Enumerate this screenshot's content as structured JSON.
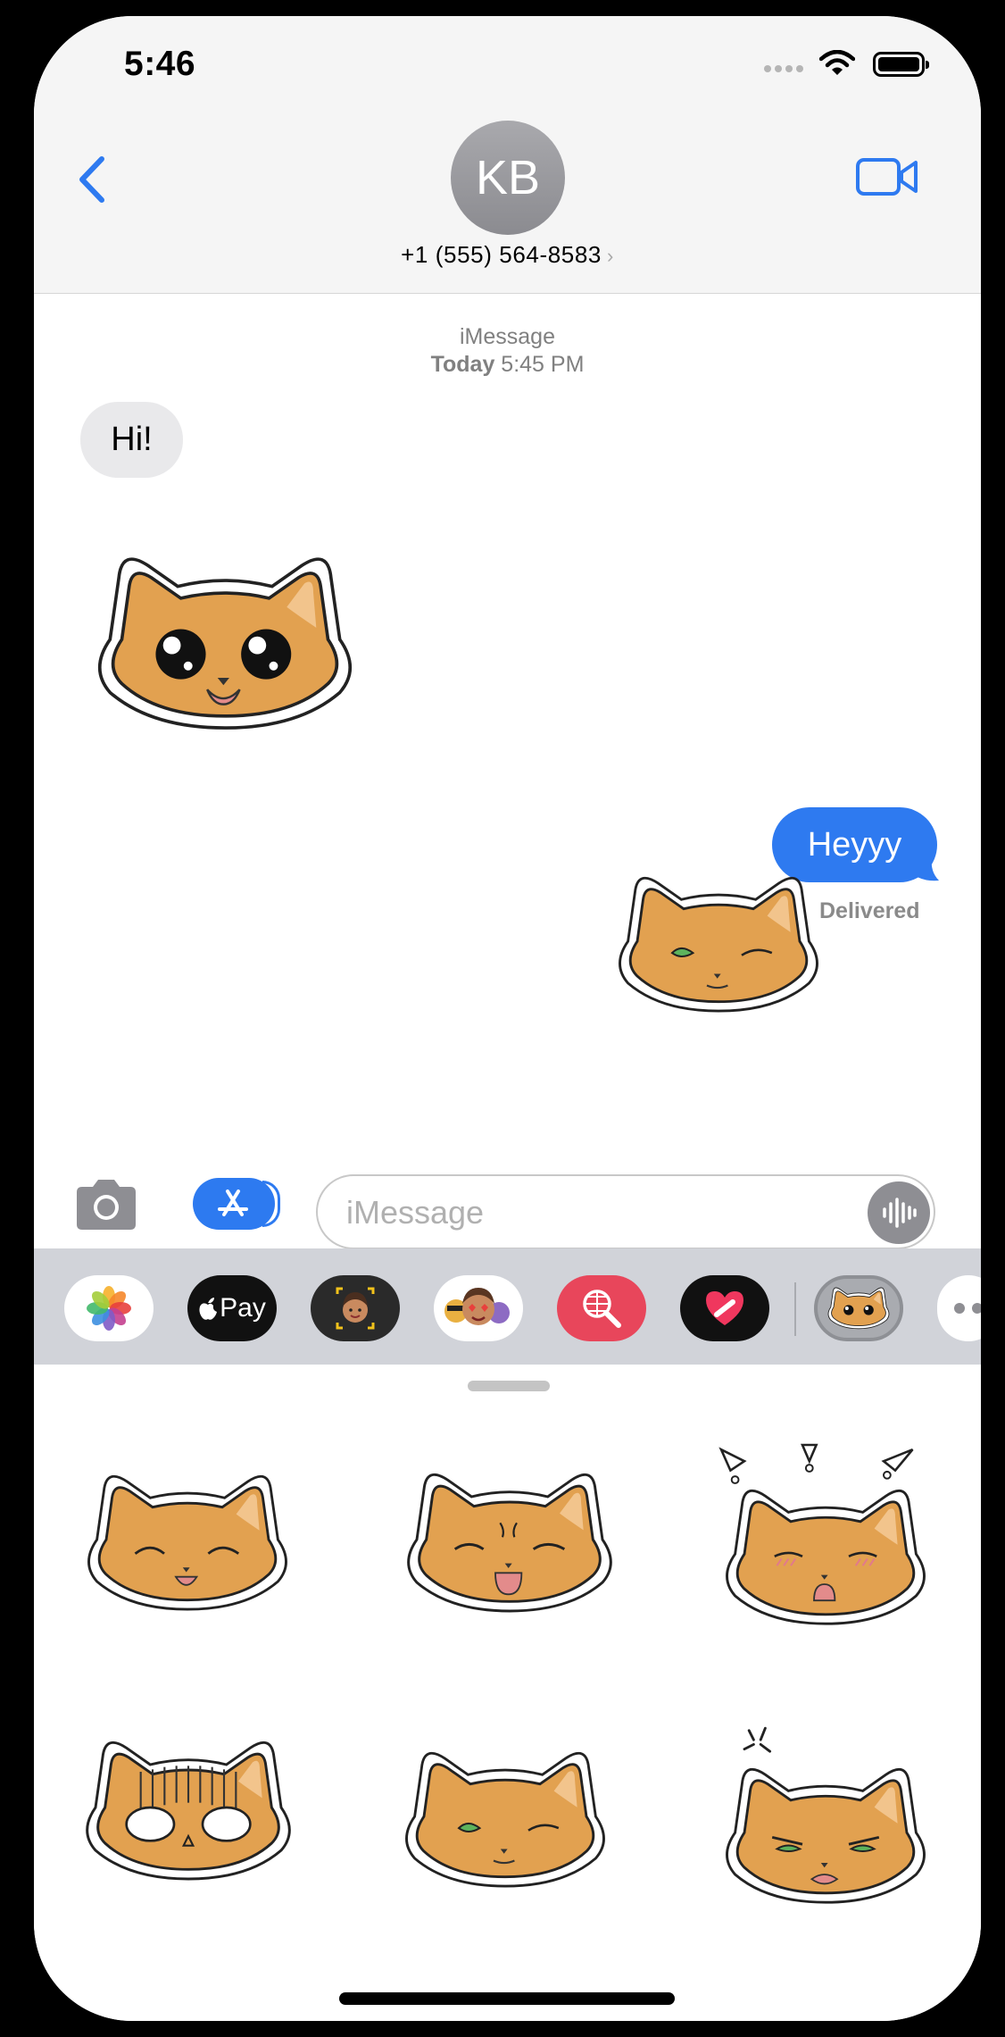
{
  "status_bar": {
    "time": "5:46"
  },
  "header": {
    "avatar_initials": "KB",
    "contact": "+1 (555) 564-8583",
    "chevron": "›"
  },
  "conversation": {
    "service": "iMessage",
    "timestamp_day": "Today",
    "timestamp_time": "5:45 PM",
    "incoming_text": "Hi!",
    "outgoing_text": "Heyyy",
    "delivery_status": "Delivered",
    "stickers": [
      {
        "name": "cat-big-eyes-sticker",
        "expression": "big sparkling eyes"
      },
      {
        "name": "cat-wink-sticker",
        "expression": "winking"
      }
    ]
  },
  "input": {
    "placeholder": "iMessage"
  },
  "app_strip": {
    "items": [
      {
        "name": "photos",
        "icon": "photos-flower-icon"
      },
      {
        "name": "apple-pay",
        "label": "Pay",
        "icon": "apple-logo-icon"
      },
      {
        "name": "memoji",
        "icon": "memoji-icon"
      },
      {
        "name": "memoji-stickers",
        "icon": "emoji-faces-icon"
      },
      {
        "name": "image-search",
        "icon": "globe-search-icon"
      },
      {
        "name": "digital-touch",
        "icon": "heart-icon"
      },
      {
        "name": "cat-stickers",
        "icon": "cat-face-icon",
        "selected": true
      },
      {
        "name": "more",
        "icon": "more-icon"
      }
    ]
  },
  "sticker_drawer": {
    "stickers": [
      {
        "name": "cat-happy-closed-eyes"
      },
      {
        "name": "cat-laughing"
      },
      {
        "name": "cat-surprised-blush"
      },
      {
        "name": "cat-shocked-white-eyes"
      },
      {
        "name": "cat-wink"
      },
      {
        "name": "cat-annoyed"
      }
    ]
  },
  "colors": {
    "accent_blue": "#2e7af0",
    "incoming_bubble": "#e9e9eb",
    "cat_fur": "#e2a150",
    "cat_ear": "#f2c48c"
  }
}
